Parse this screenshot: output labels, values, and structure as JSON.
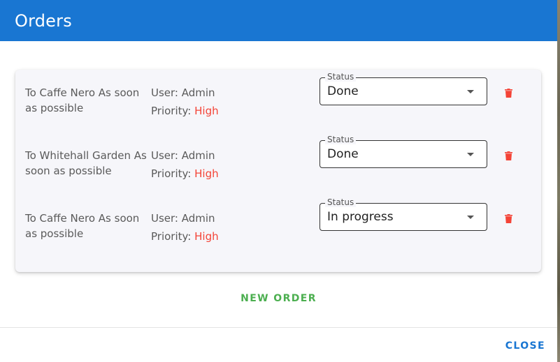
{
  "dialog": {
    "title": "Orders",
    "new_order_label": "NEW ORDER",
    "close_label": "CLOSE"
  },
  "orders": [
    {
      "description": "To Caffe Nero As soon as possible",
      "user": "User: Admin",
      "priority_label": "Priority: ",
      "priority_value": "High",
      "status_label": "Status",
      "status_value": "Done"
    },
    {
      "description": "To Whitehall Garden As soon as possible",
      "user": "User: Admin",
      "priority_label": "Priority: ",
      "priority_value": "High",
      "status_label": "Status",
      "status_value": "Done"
    },
    {
      "description": "To Caffe Nero As soon as possible",
      "user": "User: Admin",
      "priority_label": "Priority: ",
      "priority_value": "High",
      "status_label": "Status",
      "status_value": "In progress"
    }
  ],
  "colors": {
    "header": "#1976d2",
    "priority_high": "#f44336",
    "delete_icon": "#f44336",
    "new_order": "#4caf50",
    "close": "#1976d2"
  },
  "icons": {
    "delete": "trash-icon",
    "dropdown": "chevron-down-icon"
  }
}
